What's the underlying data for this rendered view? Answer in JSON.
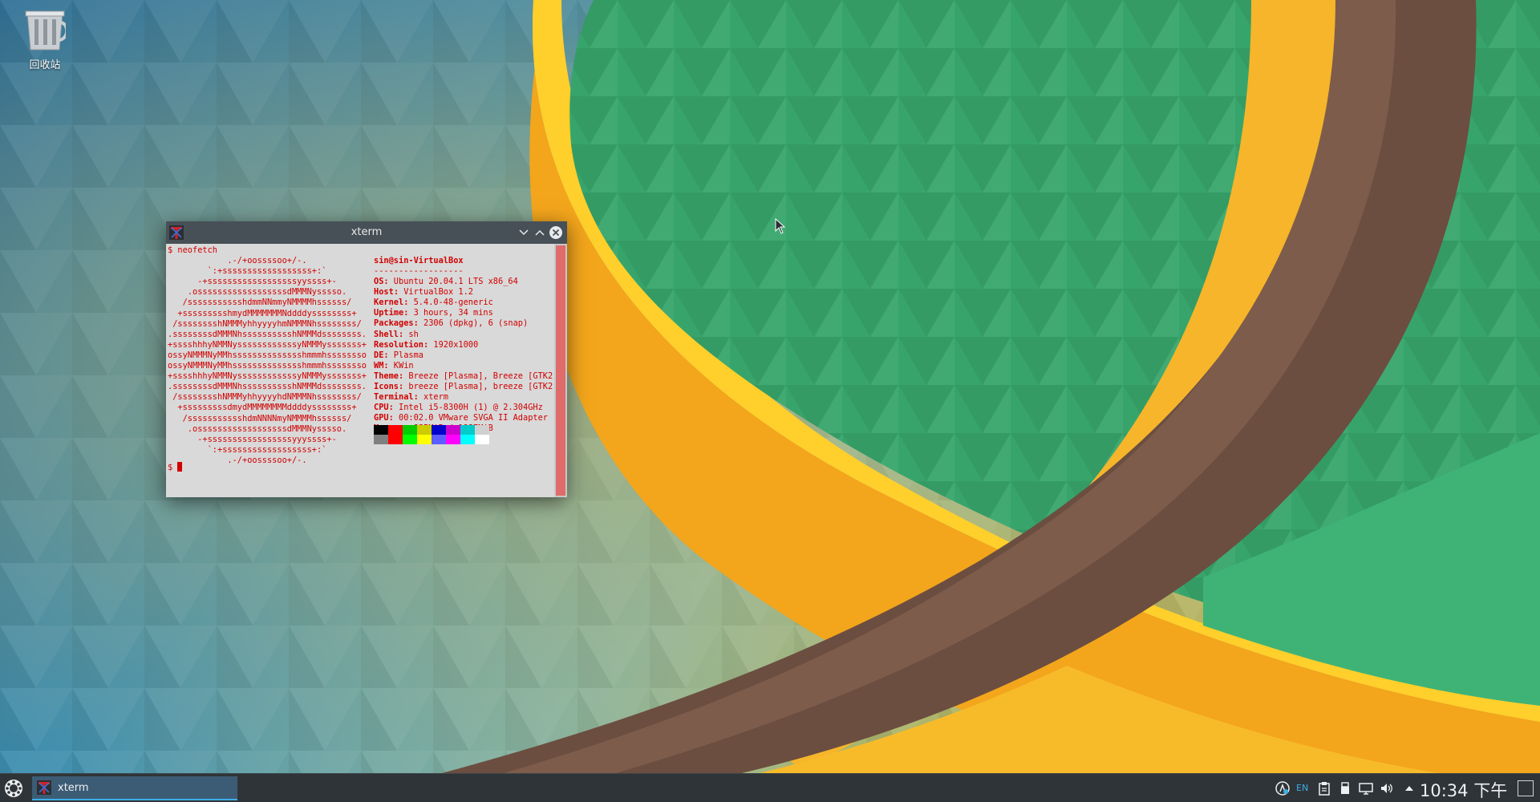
{
  "desktop": {
    "icons": [
      {
        "label": "回收站",
        "icon": "trash-icon"
      }
    ]
  },
  "xterm": {
    "title": "xterm",
    "command_line": "$ neofetch",
    "prompt_line": "$ ",
    "ascii_art": [
      "            .-/+oossssoo+/-.",
      "        `:+ssssssssssssssssss+:`",
      "      -+ssssssssssssssssssyyssss+-",
      "    .ossssssssssssssssssdMMMNysssso.",
      "   /ssssssssssshdmmNNmmyNMMMMhssssss/",
      "  +ssssssssshmydMMMMMMMNddddyssssssss+",
      " /sssssssshNMMMyhhyyyyhmNMMMNhssssssss/",
      ".ssssssssdMMMNhsssssssssshNMMMdssssssss.",
      "+sssshhhyNMMNyssssssssssssyNMMMysssssss+",
      "ossyNMMMNyMMhsssssssssssssshmmmhssssssso",
      "ossyNMMMNyMMhsssssssssssssshmmmhssssssso",
      "+sssshhhyNMMNyssssssssssssyNMMMysssssss+",
      ".ssssssssdMMMNhsssssssssshNMMMdssssssss.",
      " /sssssssshNMMMyhhyyyyhdNMMMNhssssssss/",
      "  +sssssssssdmydMMMMMMMMddddyssssssss+",
      "   /ssssssssssshdmNNNNmyNMMMMhssssss/",
      "    .ossssssssssssssssssdMMMNysssso.",
      "      -+sssssssssssssssssyyyssss+-",
      "        `:+ssssssssssssssssss+:`",
      "            .-/+oossssoo+/-."
    ],
    "info": {
      "user_host": "sin@sin-VirtualBox",
      "separator": "------------------",
      "fields": [
        {
          "key": "OS",
          "value": " Ubuntu 20.04.1 LTS x86_64"
        },
        {
          "key": "Host",
          "value": " VirtualBox 1.2"
        },
        {
          "key": "Kernel",
          "value": " 5.4.0-48-generic"
        },
        {
          "key": "Uptime",
          "value": " 3 hours, 34 mins"
        },
        {
          "key": "Packages",
          "value": " 2306 (dpkg), 6 (snap)"
        },
        {
          "key": "Shell",
          "value": " sh"
        },
        {
          "key": "Resolution",
          "value": " 1920x1000"
        },
        {
          "key": "DE",
          "value": " Plasma"
        },
        {
          "key": "WM",
          "value": " KWin"
        },
        {
          "key": "Theme",
          "value": " Breeze [Plasma], Breeze [GTK2"
        },
        {
          "key": "Icons",
          "value": " breeze [Plasma], breeze [GTK2"
        },
        {
          "key": "Terminal",
          "value": " xterm"
        },
        {
          "key": "CPU",
          "value": " Intel i5-8300H (1) @ 2.304GHz"
        },
        {
          "key": "GPU",
          "value": " 00:02.0 VMware SVGA II Adapter"
        },
        {
          "key": "Memory",
          "value": " 885MiB / 1987MiB"
        }
      ]
    },
    "palette_top": [
      "#000000",
      "#ff0000",
      "#00cc00",
      "#cccc00",
      "#0000cc",
      "#cc00cc",
      "#00cccc",
      "#d0d0d0"
    ],
    "palette_bottom": [
      "#808080",
      "#ff0000",
      "#00ff00",
      "#ffff00",
      "#5c5cff",
      "#ff00ff",
      "#00ffff",
      "#ffffff"
    ],
    "text_color": "#d10000",
    "background_color": "#d9d9d9"
  },
  "taskbar": {
    "tasks": [
      {
        "label": "xterm",
        "icon": "xterm-icon",
        "active": true
      }
    ],
    "tray_icons": [
      "network-status-icon",
      "keyboard-layout-icon",
      "clipboard-icon",
      "usb-device-icon",
      "display-icon",
      "volume-icon",
      "expand-tray-icon"
    ],
    "keyboard_layout": "EN",
    "clock": "10:34 下午"
  }
}
